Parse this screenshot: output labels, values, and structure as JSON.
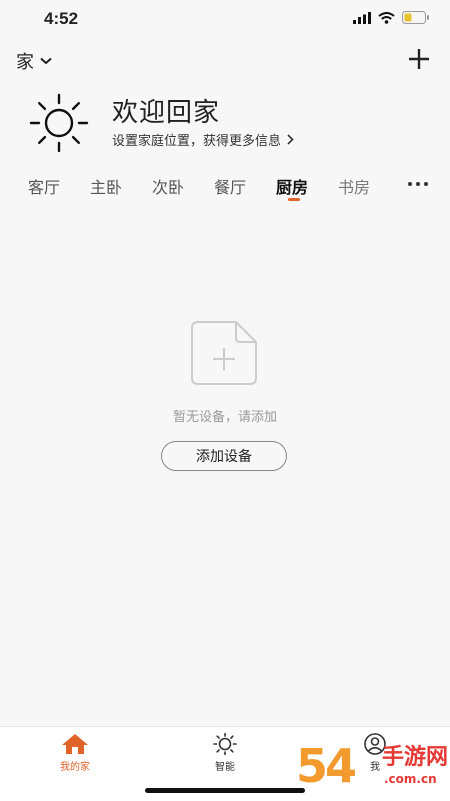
{
  "status_bar": {
    "time": "4:52"
  },
  "header": {
    "home_label": "家"
  },
  "welcome": {
    "title": "欢迎回家",
    "subtitle": "设置家庭位置，获得更多信息"
  },
  "rooms": {
    "tabs": [
      "客厅",
      "主卧",
      "次卧",
      "餐厅",
      "厨房",
      "书房"
    ],
    "active": "厨房"
  },
  "empty_state": {
    "message": "暂无设备，请添加",
    "button_label": "添加设备"
  },
  "bottom_nav": {
    "items": [
      {
        "label": "我的家",
        "icon": "home-icon",
        "active": true
      },
      {
        "label": "智能",
        "icon": "sun-icon",
        "active": false
      },
      {
        "label": "我",
        "icon": "user-icon",
        "active": false
      }
    ]
  },
  "watermark": {
    "number": "54",
    "title": "手游网",
    "domain": ".com.cn"
  },
  "colors": {
    "accent": "#e0632a",
    "background": "#f7f7f7",
    "nav_background": "#ffffff"
  }
}
